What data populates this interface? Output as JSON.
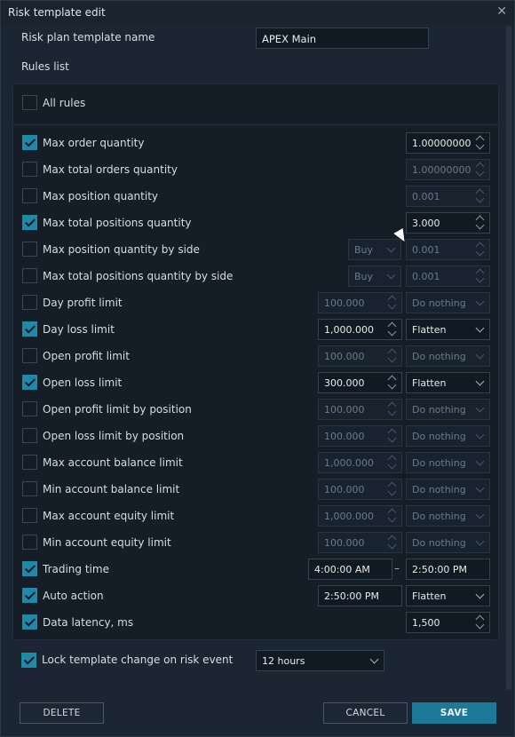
{
  "window": {
    "title": "Risk template edit",
    "close_glyph": "✕"
  },
  "template_name": {
    "label": "Risk plan template name",
    "value": "APEX Main"
  },
  "rules_list_label": "Rules list",
  "all_rules": {
    "label": "All rules",
    "checked": false
  },
  "rules": [
    {
      "label": "Max order quantity",
      "checked": true,
      "value": "1.00000000"
    },
    {
      "label": "Max total orders quantity",
      "checked": false,
      "value": "1.00000000"
    },
    {
      "label": "Max position quantity",
      "checked": false,
      "value": "0.001"
    },
    {
      "label": "Max total positions quantity",
      "checked": true,
      "value": "3.000"
    },
    {
      "label": "Max position quantity by side",
      "checked": false,
      "side": "Buy",
      "value": "0.001"
    },
    {
      "label": "Max total positions quantity by side",
      "checked": false,
      "side": "Buy",
      "value": "0.001"
    },
    {
      "label": "Day profit limit",
      "checked": false,
      "value": "100.000",
      "action": "Do nothing"
    },
    {
      "label": "Day loss limit",
      "checked": true,
      "value": "1,000.000",
      "action": "Flatten"
    },
    {
      "label": "Open profit limit",
      "checked": false,
      "value": "100.000",
      "action": "Do nothing"
    },
    {
      "label": "Open loss limit",
      "checked": true,
      "value": "300.000",
      "action": "Flatten"
    },
    {
      "label": "Open profit limit by position",
      "checked": false,
      "value": "100.000",
      "action": "Do nothing"
    },
    {
      "label": "Open loss limit by position",
      "checked": false,
      "value": "100.000",
      "action": "Do nothing"
    },
    {
      "label": "Max account balance limit",
      "checked": false,
      "value": "1,000.000",
      "action": "Do nothing"
    },
    {
      "label": "Min account balance limit",
      "checked": false,
      "value": "100.000",
      "action": "Do nothing"
    },
    {
      "label": "Max account equity limit",
      "checked": false,
      "value": "1,000.000",
      "action": "Do nothing"
    },
    {
      "label": "Min account equity limit",
      "checked": false,
      "value": "100.000",
      "action": "Do nothing"
    },
    {
      "label": "Trading time",
      "checked": true,
      "start": "4:00:00 AM",
      "end": "2:50:00 PM",
      "range_separator": "–"
    },
    {
      "label": "Auto action",
      "checked": true,
      "time": "2:50:00 PM",
      "action": "Flatten"
    },
    {
      "label": "Data latency, ms",
      "checked": true,
      "value": "1,500"
    }
  ],
  "lock": {
    "label": "Lock template change on risk event",
    "checked": true,
    "value": "12 hours"
  },
  "buttons": {
    "delete": "DELETE",
    "cancel": "CANCEL",
    "save": "SAVE"
  },
  "colors": {
    "accent": "#1f8aa8",
    "background": "#1c2632",
    "panel": "#151d27"
  }
}
